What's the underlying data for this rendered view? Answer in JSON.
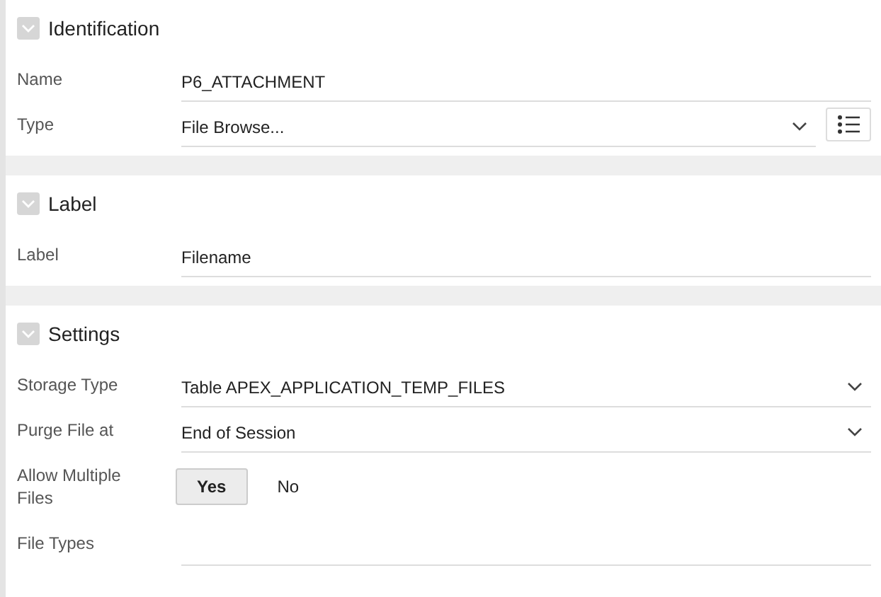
{
  "sections": [
    {
      "title": "Identification",
      "expanded": true,
      "fields": [
        {
          "kind": "text",
          "label": "Name",
          "value": "P6_ATTACHMENT"
        },
        {
          "kind": "select",
          "label": "Type",
          "value": "File Browse...",
          "list_button": true
        }
      ]
    },
    {
      "title": "Label",
      "expanded": true,
      "fields": [
        {
          "kind": "text",
          "label": "Label",
          "value": "Filename"
        }
      ]
    },
    {
      "title": "Settings",
      "expanded": true,
      "fields": [
        {
          "kind": "select",
          "label": "Storage Type",
          "value": "Table APEX_APPLICATION_TEMP_FILES",
          "list_button": false
        },
        {
          "kind": "select",
          "label": "Purge File at",
          "value": "End of Session",
          "list_button": false
        },
        {
          "kind": "toggle",
          "label": "Allow Multiple Files",
          "options": [
            {
              "label": "Yes",
              "selected": true
            },
            {
              "label": "No",
              "selected": false
            }
          ]
        },
        {
          "kind": "text",
          "label": "File Types"
        }
      ]
    }
  ]
}
